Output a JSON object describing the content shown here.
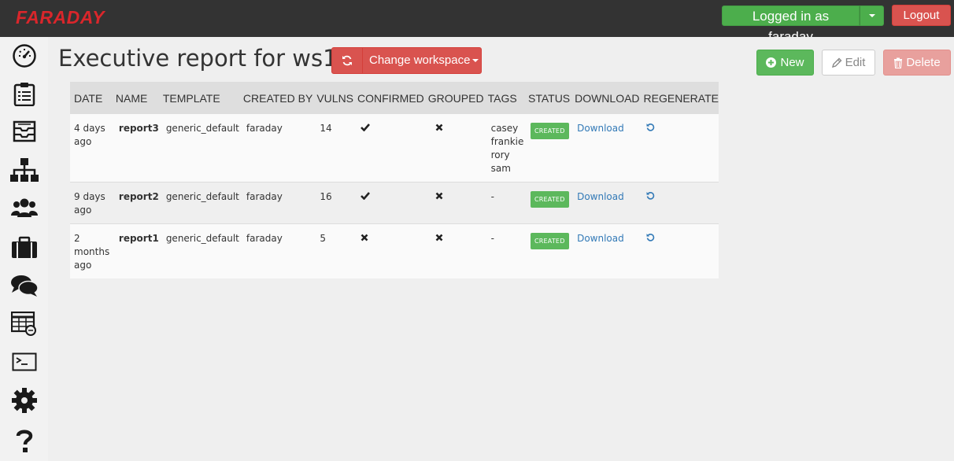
{
  "header": {
    "logo": "FARADAY",
    "login_label": "Logged in as faraday",
    "logout_label": "Logout"
  },
  "sidebar": {
    "items": [
      {
        "icon": "dashboard-gauge-icon"
      },
      {
        "icon": "clipboard-icon"
      },
      {
        "icon": "inbox-stack-icon"
      },
      {
        "icon": "sitemap-icon"
      },
      {
        "icon": "users-icon"
      },
      {
        "icon": "briefcase-icon"
      },
      {
        "icon": "chat-bubbles-icon"
      },
      {
        "icon": "table-grid-icon"
      },
      {
        "icon": "terminal-icon"
      },
      {
        "icon": "gear-icon"
      },
      {
        "icon": "question-icon"
      }
    ]
  },
  "page": {
    "title": "Executive report for ws1",
    "workspace_button": "Change workspace",
    "new_label": "New",
    "edit_label": "Edit",
    "delete_label": "Delete"
  },
  "table": {
    "headers": [
      "DATE",
      "NAME",
      "TEMPLATE",
      "CREATED BY",
      "VULNS",
      "CONFIRMED",
      "GROUPED",
      "TAGS",
      "STATUS",
      "DOWNLOAD",
      "REGENERATE"
    ],
    "rows": [
      {
        "date": "4 days ago",
        "name": "report3",
        "template": "generic_default",
        "created_by": "faraday",
        "vulns": "14",
        "confirmed": true,
        "grouped": false,
        "tags": [
          "casey",
          "frankie",
          "rory",
          "sam"
        ],
        "status": "CREATED",
        "download": "Download"
      },
      {
        "date": "9 days ago",
        "name": "report2",
        "template": "generic_default",
        "created_by": "faraday",
        "vulns": "16",
        "confirmed": true,
        "grouped": false,
        "tags": [
          "-"
        ],
        "status": "CREATED",
        "download": "Download"
      },
      {
        "date": "2 months ago",
        "name": "report1",
        "template": "generic_default",
        "created_by": "faraday",
        "vulns": "5",
        "confirmed": false,
        "grouped": false,
        "tags": [
          "-"
        ],
        "status": "CREATED",
        "download": "Download"
      }
    ]
  },
  "colors": {
    "navbar": "#333333",
    "logo": "#d9262b",
    "success": "#5cb85c",
    "danger": "#d9534f",
    "link": "#337ab7"
  }
}
